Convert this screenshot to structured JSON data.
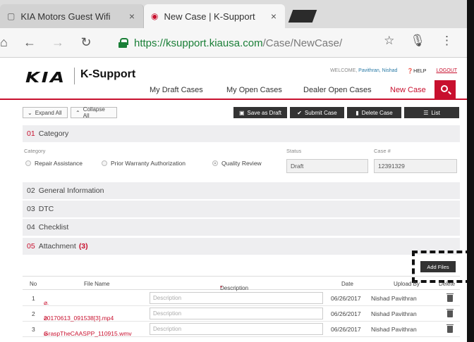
{
  "browser": {
    "tabs": [
      {
        "label": "KIA Motors Guest Wifi",
        "close": "×"
      },
      {
        "label": "New Case | K-Support",
        "close": "×"
      }
    ],
    "url_host": "https://ksupport.kiausa.com",
    "url_path": "/Case/NewCase/"
  },
  "header": {
    "logo_text": "KIA",
    "brand": "K-Support",
    "welcome_label": "WELCOME,",
    "user": "Pavithran, Nishad",
    "help": "HELP",
    "logout": "LOGOUT",
    "nav": [
      "My Draft Cases",
      "My Open Cases",
      "Dealer Open Cases",
      "New Case"
    ]
  },
  "actions": {
    "expand_all": "Expand All",
    "collapse_all": "Collapse All",
    "save_draft": "Save as Draft",
    "submit_case": "Submit Case",
    "delete_case": "Delete Case",
    "list": "List"
  },
  "sections": {
    "category": {
      "num": "01",
      "title": "Category"
    },
    "general": {
      "num": "02",
      "title": "General Information"
    },
    "dtc": {
      "num": "03",
      "title": "DTC"
    },
    "checklist": {
      "num": "04",
      "title": "Checklist"
    },
    "attachment": {
      "num": "05",
      "title": "Attachment",
      "count": "(3)"
    }
  },
  "form": {
    "category_label": "Category",
    "options": [
      "Repair Assistance",
      "Prior Warranty Authorization",
      "Quality Review"
    ],
    "selected": "Quality Review",
    "status_label": "Status",
    "status_value": "Draft",
    "case_label": "Case #",
    "case_value": "12391329"
  },
  "attachments": {
    "add_files": "Add Files",
    "headers": {
      "no": "No",
      "file": "File Name",
      "desc": "Description",
      "req": "*",
      "date": "Date",
      "upload": "Upload By",
      "delete": "Delete"
    },
    "desc_placeholder": "Description",
    "rows": [
      {
        "no": "1",
        "file": "...",
        "date": "06/26/2017",
        "by": "Nishad Pavithran"
      },
      {
        "no": "2",
        "file": "20170613_091538[3].mp4",
        "date": "06/26/2017",
        "by": "Nishad Pavithran"
      },
      {
        "no": "3",
        "file": "GraspTheCAASPP_110915.wmv",
        "date": "06/26/2017",
        "by": "Nishad Pavithran"
      }
    ]
  }
}
